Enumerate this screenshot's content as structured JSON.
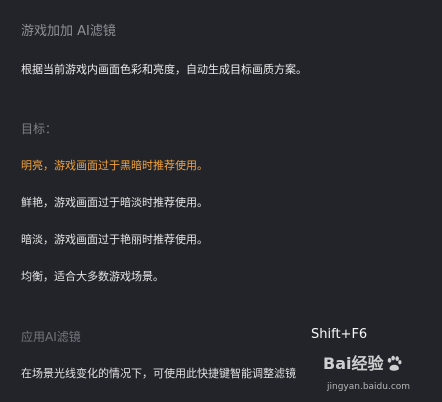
{
  "panel": {
    "title": "游戏加加 AI滤镜",
    "description": "根据当前游戏内画面色彩和亮度，自动生成目标画质方案。",
    "goals_heading": "目标：",
    "options": [
      {
        "label": "明亮，游戏画面过于黑暗时推荐使用。",
        "highlighted": true,
        "color": "#f2a23a"
      },
      {
        "label": "鲜艳，游戏画面过于暗淡时推荐使用。",
        "highlighted": false
      },
      {
        "label": "暗淡，游戏画面过于艳丽时推荐使用。",
        "highlighted": false
      },
      {
        "label": "均衡，适合大多数游戏场景。",
        "highlighted": false
      }
    ],
    "apply_heading": "应用AI滤镜",
    "shortcut": "Shift+F6",
    "apply_description": "在场景光线变化的情况下，可使用此快捷键智能调整滤镜"
  },
  "watermark": {
    "logo": "Bai经验",
    "url": "jingyan.baidu.com",
    "icon": "baidu-paw-icon"
  },
  "colors": {
    "background": "#232429",
    "accent": "#f2a23a"
  }
}
